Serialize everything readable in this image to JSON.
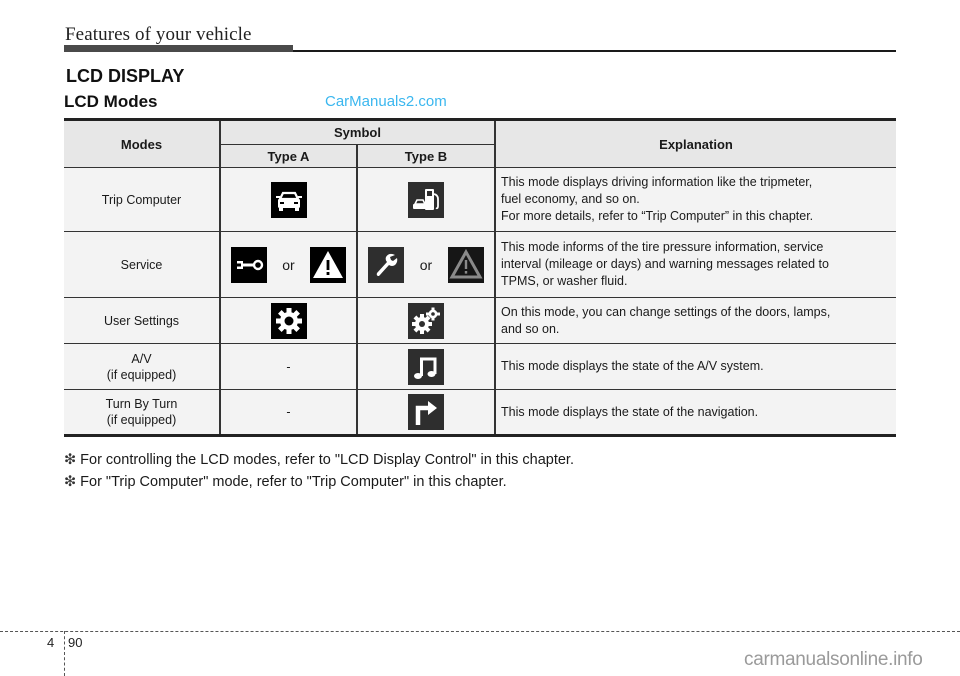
{
  "header": {
    "section": "Features of your vehicle",
    "title": "LCD DISPLAY",
    "subtitle": "LCD Modes",
    "watermark": "CarManuals2.com"
  },
  "table": {
    "headers": {
      "modes": "Modes",
      "symbol": "Symbol",
      "type_a": "Type A",
      "type_b": "Type B",
      "explanation": "Explanation"
    },
    "rows": [
      {
        "mode": [
          "Trip Computer"
        ],
        "type_a": {
          "icons": [
            "car-icon"
          ]
        },
        "type_b": {
          "icons": [
            "fuel-pump-car-icon"
          ]
        },
        "explanation": [
          "This mode displays driving information like the tripmeter,",
          "fuel economy, and so on.",
          "For more details, refer to “Trip Computer” in this chapter."
        ]
      },
      {
        "mode": [
          "Service"
        ],
        "type_a": {
          "icons": [
            "wrench-icon",
            "warning-triangle-icon"
          ],
          "separator": "or"
        },
        "type_b": {
          "icons": [
            "wrench-icon",
            "warning-triangle-icon"
          ],
          "separator": "or"
        },
        "explanation": [
          "This mode informs of the tire pressure information, service",
          "interval (mileage or days) and warning messages related to",
          "TPMS, or washer fluid."
        ]
      },
      {
        "mode": [
          "User Settings"
        ],
        "type_a": {
          "icons": [
            "gear-icon"
          ]
        },
        "type_b": {
          "icons": [
            "gears-icon"
          ]
        },
        "explanation": [
          "On this mode, you can change settings of the doors, lamps,",
          "and so on."
        ]
      },
      {
        "mode": [
          "A/V",
          "(if equipped)"
        ],
        "type_a": {
          "text": "-"
        },
        "type_b": {
          "icons": [
            "music-note-icon"
          ]
        },
        "explanation": [
          "This mode displays the state of the A/V system."
        ]
      },
      {
        "mode": [
          "Turn By Turn",
          "(if equipped)"
        ],
        "type_a": {
          "text": "-"
        },
        "type_b": {
          "icons": [
            "turn-right-arrow-icon"
          ]
        },
        "explanation": [
          "This mode displays the state of the navigation."
        ]
      }
    ]
  },
  "notes": {
    "marker": "❇",
    "items": [
      "For controlling the LCD modes, refer to \"LCD Display Control\" in this chapter.",
      "For \"Trip Computer\" mode, refer to \"Trip Computer\" in this chapter."
    ]
  },
  "footer": {
    "chapter": "4",
    "page": "90",
    "watermark": "carmanualsonline.info"
  },
  "colors": {
    "watermark_top": "#3bb7ef",
    "header_bar": "#4a4a4a",
    "table_header_bg": "#e7e7e7",
    "table_body_bg": "#f3f3f3",
    "icon_type_a_bg": "#000000",
    "icon_type_b_bg": "#2e2e2e"
  }
}
